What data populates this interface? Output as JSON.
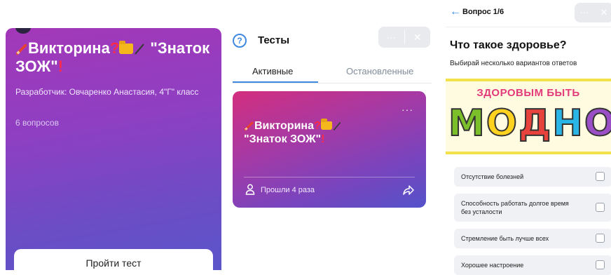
{
  "panel1": {
    "title_word1": "Викторина",
    "title_quote": "\"Знаток ЗОЖ\"",
    "author": "Разработчик: Овчаренко Анастасия, 4\"Г\" класс",
    "questions_count": "6 вопросов",
    "start_button": "Пройти тест"
  },
  "panel2": {
    "header_title": "Тесты",
    "help_icon_glyph": "?",
    "more_glyph": "···",
    "close_glyph": "✕",
    "tabs": [
      "Активные",
      "Остановленные"
    ],
    "card": {
      "title_word1": "Викторина",
      "title_quote": "\"Знаток ЗОЖ\"",
      "more_glyph": "···",
      "passed": "Прошли 4 раза"
    }
  },
  "panel3": {
    "back_glyph": "←",
    "question_counter": "Вопрос 1/6",
    "more_glyph": "···",
    "close_glyph": "✕",
    "question": "Что такое здоровье?",
    "hint": "Выбирай несколько вариантов ответов",
    "poster": {
      "top_text": "ЗДОРОВЫМ БЫТЬ",
      "big_letters": [
        "М",
        "О",
        "Д",
        "Н",
        "О"
      ]
    },
    "options": [
      "Отсутствие болезней",
      "Способность работать долгое время без усталости",
      "Стремление быть лучше всех",
      "Хорошее настроение"
    ]
  },
  "icons": {
    "pencil": "pencil-icon",
    "question_mark": "red-question-icon",
    "folder": "folder-icon",
    "exclamation": "red-exclamation-icon",
    "user": "user-icon",
    "share": "share-icon"
  },
  "colors": {
    "accent": "#3f8ae0",
    "gradient_start": "#d32e7e",
    "gradient_end": "#5452c9"
  }
}
